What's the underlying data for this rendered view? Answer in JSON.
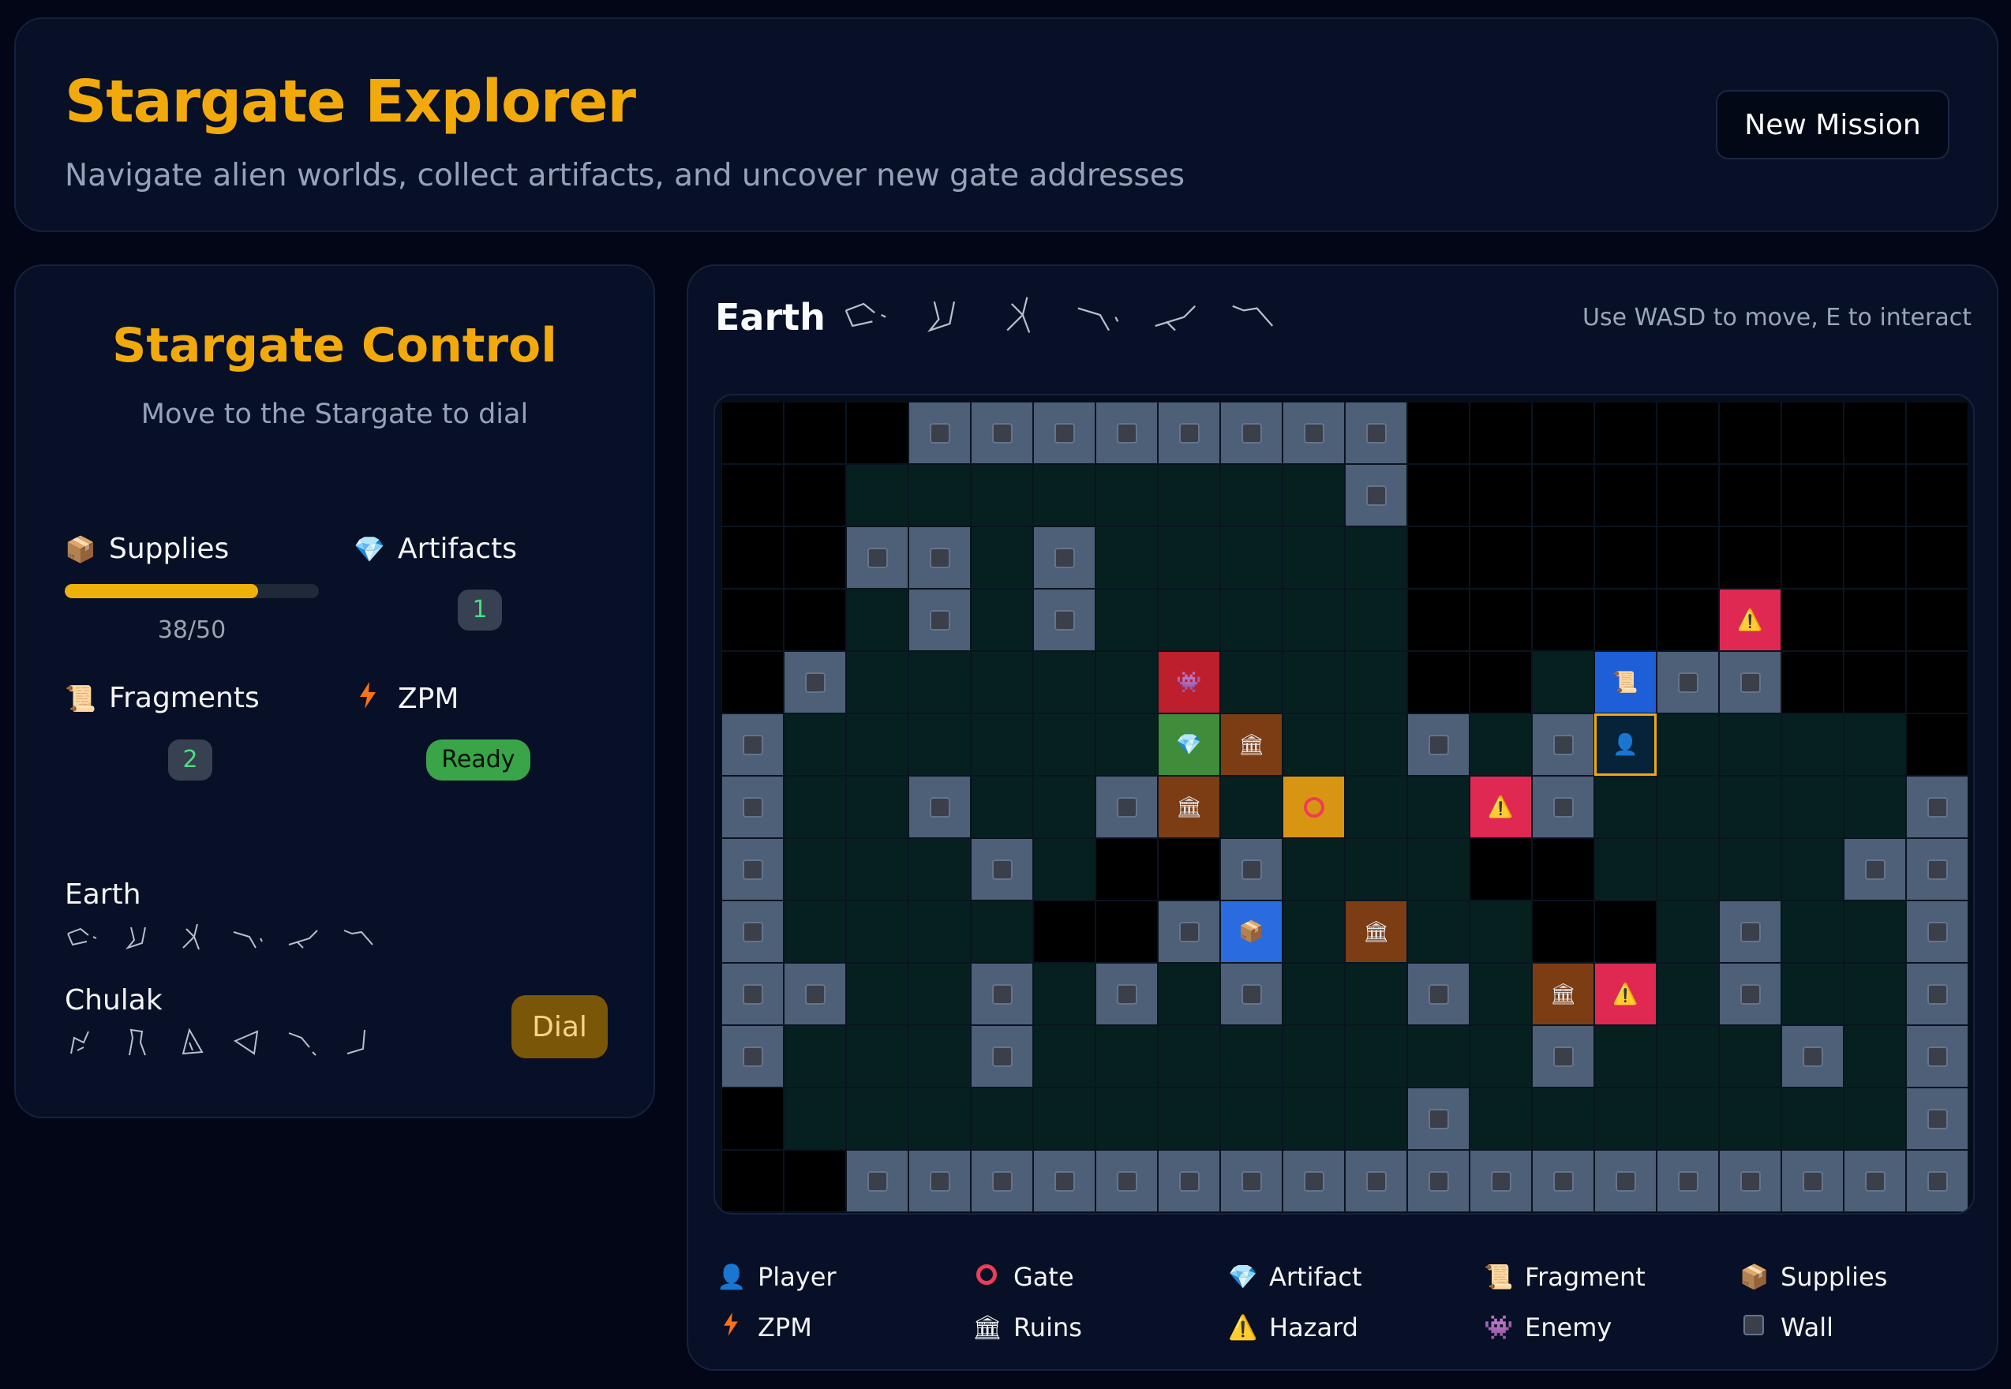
{
  "header": {
    "title": "Stargate Explorer",
    "subtitle": "Navigate alien worlds, collect artifacts, and uncover new gate addresses",
    "new_mission_label": "New Mission"
  },
  "control": {
    "title": "Stargate Control",
    "hint": "Move to the Stargate to dial",
    "supplies_label": "Supplies",
    "supplies_current": 38,
    "supplies_max": 50,
    "supplies_text": "38/50",
    "artifacts_label": "Artifacts",
    "artifacts_value": "1",
    "fragments_label": "Fragments",
    "fragments_value": "2",
    "zpm_label": "ZPM",
    "zpm_status": "Ready",
    "addresses": [
      {
        "name": "Earth"
      },
      {
        "name": "Chulak"
      }
    ],
    "dial_label": "Dial"
  },
  "map": {
    "planet": "Earth",
    "controls_hint": "Use WASD to move, E to interact",
    "rows": [
      "...WWWWWWWW.........",
      "..FFFFFFFFW.........",
      "..WWFWFFFFF.........",
      "..FWFWFFFFF.....H...",
      ".WFFFFFEFFF..FDWW...",
      "WFFFFFFAUFFWFWPFFFF.",
      "WFFWFFWUFGFFHWFFFFFW",
      "WFFFWF..WFFF..FFFFWW",
      "WFFFF..WSFUFF..FWFFW",
      "WWFFWFWFWFFWFUHFWFFW",
      "WFFFWFFFFFFFFWFFFWFW",
      ".FFFFFFFFFFWFFFFFFFW",
      "..WWWWWWWWWWWWWWWWWW"
    ]
  },
  "legend": [
    {
      "label": "Player",
      "icon": "player-icon"
    },
    {
      "label": "Gate",
      "icon": "gate-icon"
    },
    {
      "label": "Artifact",
      "icon": "artifact-icon"
    },
    {
      "label": "Fragment",
      "icon": "fragment-icon"
    },
    {
      "label": "Supplies",
      "icon": "supplies-icon"
    },
    {
      "label": "ZPM",
      "icon": "zpm-icon"
    },
    {
      "label": "Ruins",
      "icon": "ruins-icon"
    },
    {
      "label": "Hazard",
      "icon": "hazard-icon"
    },
    {
      "label": "Enemy",
      "icon": "enemy-icon"
    },
    {
      "label": "Wall",
      "icon": "wall-icon"
    }
  ],
  "colors": {
    "accent": "#f2a90c",
    "zpm_ready": "#3aa548",
    "supplies_bar": "#eeb10a"
  }
}
